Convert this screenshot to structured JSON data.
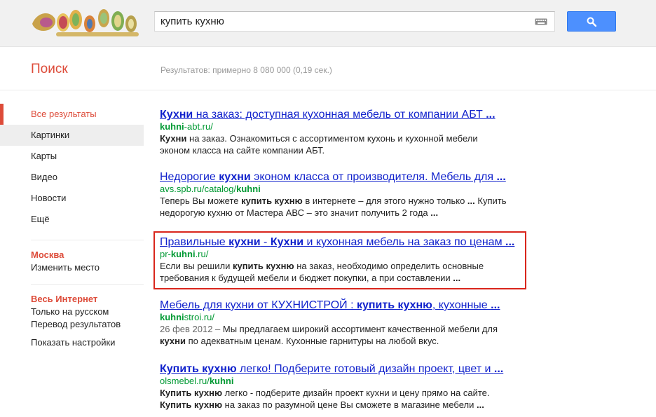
{
  "header": {
    "query": "купить кухню",
    "search_icon": "magnifier-icon",
    "keyboard_icon": "keyboard-icon"
  },
  "subheader": {
    "title": "Поиск",
    "stats": "Результатов: примерно 8 080 000 (0,19 сек.)"
  },
  "nav": {
    "items": [
      {
        "label": "Все результаты"
      },
      {
        "label": "Картинки"
      },
      {
        "label": "Карты"
      },
      {
        "label": "Видео"
      },
      {
        "label": "Новости"
      },
      {
        "label": "Ещё"
      }
    ],
    "location_title": "Москва",
    "location_change": "Изменить место",
    "web_title": "Весь Интернет",
    "web_links": [
      "Только на русском",
      "Перевод результатов"
    ],
    "settings": "Показать настройки"
  },
  "colors": {
    "accent": "#dd4b39",
    "link": "#1122cc",
    "url": "#009933",
    "button": "#4d90fe",
    "highlight_border": "#d9261c"
  },
  "results": [
    {
      "title": [
        [
          "Кухни",
          true
        ],
        [
          " на заказ: доступная кухонная мебель от компании АБТ ",
          false
        ],
        [
          "...",
          true
        ]
      ],
      "url": [
        [
          "kuhni",
          true
        ],
        [
          "-abt.ru/",
          false
        ]
      ],
      "snippet": [
        [
          [
            "Кухни",
            true
          ],
          [
            " на заказ. Ознакомиться с ассортиментом кухонь и кухонной мебели",
            false
          ]
        ],
        [
          [
            "эконом класса на сайте компании АБТ.",
            false
          ]
        ]
      ]
    },
    {
      "title": [
        [
          "Недорогие ",
          false
        ],
        [
          "кухни",
          true
        ],
        [
          " эконом класса от производителя. Мебель для ",
          false
        ],
        [
          "...",
          true
        ]
      ],
      "url": [
        [
          "avs.spb.ru/catalog/",
          false
        ],
        [
          "kuhni",
          true
        ]
      ],
      "snippet": [
        [
          [
            "Теперь Вы можете ",
            false
          ],
          [
            "купить кухню",
            true
          ],
          [
            " в интернете – для этого нужно только ",
            false
          ],
          [
            "...",
            true
          ],
          [
            " Купить",
            false
          ]
        ],
        [
          [
            "недорогую кухню от Мастера АВС – это значит получить 2 года ",
            false
          ],
          [
            "...",
            true
          ]
        ]
      ]
    },
    {
      "title": [
        [
          "Правильные ",
          false
        ],
        [
          "кухни",
          true
        ],
        [
          " - ",
          false
        ],
        [
          "Кухни",
          true
        ],
        [
          " и кухонная мебель на заказ по ценам ",
          false
        ],
        [
          "...",
          true
        ]
      ],
      "url": [
        [
          "pr-",
          false
        ],
        [
          "kuhni",
          true
        ],
        [
          ".ru/",
          false
        ]
      ],
      "snippet": [
        [
          [
            "Если вы решили ",
            false
          ],
          [
            "купить кухню",
            true
          ],
          [
            " на заказ, необходимо определить основные",
            false
          ]
        ],
        [
          [
            "требования к будущей мебели и бюджет покупки, а при составлении ",
            false
          ],
          [
            "...",
            true
          ]
        ]
      ]
    },
    {
      "title": [
        [
          "Мебель для кухни от КУХНИСТРОЙ : ",
          false
        ],
        [
          "купить кухню",
          true
        ],
        [
          ", кухонные ",
          false
        ],
        [
          "...",
          true
        ]
      ],
      "url": [
        [
          "kuhni",
          true
        ],
        [
          "stroi.ru/",
          false
        ]
      ],
      "date": "26 фев 2012 – ",
      "snippet": [
        [
          [
            "Мы предлагаем широкий ассортимент качественной мебели для",
            false
          ]
        ],
        [
          [
            "кухни",
            true
          ],
          [
            " по адекватным ценам. Кухонные гарнитуры на любой вкус.",
            false
          ]
        ]
      ]
    },
    {
      "title": [
        [
          "Купить кухню",
          true
        ],
        [
          " легко! Подберите готовый дизайн проект, цвет и ",
          false
        ],
        [
          "...",
          true
        ]
      ],
      "url": [
        [
          "olsmebel.ru/",
          false
        ],
        [
          "kuhni",
          true
        ]
      ],
      "snippet": [
        [
          [
            "Купить кухню",
            true
          ],
          [
            " легко - подберите дизайн проект кухни и цену прямо на сайте.",
            false
          ]
        ],
        [
          [
            "Купить кухню",
            true
          ],
          [
            " на заказ по разумной цене Вы сможете в магазине мебели ",
            false
          ],
          [
            "...",
            true
          ]
        ]
      ]
    }
  ]
}
